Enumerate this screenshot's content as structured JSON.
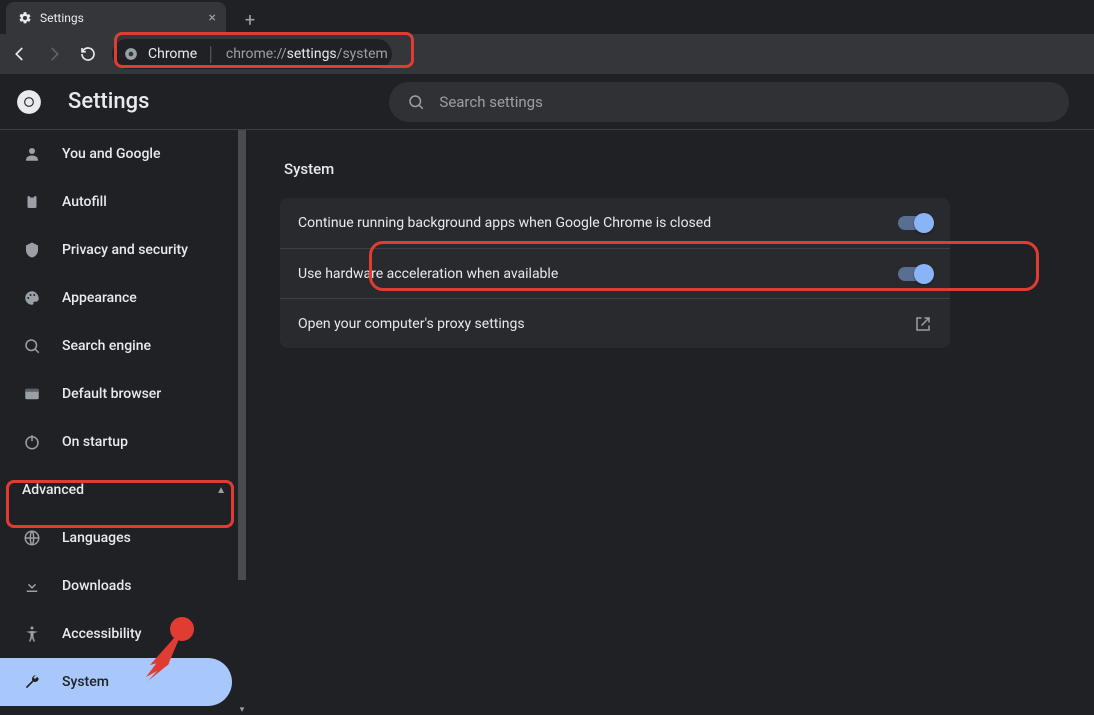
{
  "tab": {
    "title": "Settings"
  },
  "omnibox": {
    "chip": "Chrome",
    "url_prefix": "chrome://",
    "url_emph": "settings",
    "url_suffix": "/system"
  },
  "header": {
    "app_title": "Settings",
    "search_placeholder": "Search settings"
  },
  "sidebar": {
    "items": [
      {
        "id": "you",
        "label": "You and Google"
      },
      {
        "id": "autofill",
        "label": "Autofill"
      },
      {
        "id": "privacy",
        "label": "Privacy and security"
      },
      {
        "id": "appearance",
        "label": "Appearance"
      },
      {
        "id": "search",
        "label": "Search engine"
      },
      {
        "id": "default",
        "label": "Default browser"
      },
      {
        "id": "startup",
        "label": "On startup"
      }
    ],
    "advanced_label": "Advanced",
    "advanced_items": [
      {
        "id": "languages",
        "label": "Languages"
      },
      {
        "id": "downloads",
        "label": "Downloads"
      },
      {
        "id": "accessibility",
        "label": "Accessibility"
      },
      {
        "id": "system",
        "label": "System",
        "selected": true
      }
    ]
  },
  "main": {
    "section_title": "System",
    "rows": [
      {
        "id": "bg-apps",
        "label": "Continue running background apps when Google Chrome is closed",
        "toggle": true
      },
      {
        "id": "hw-accel",
        "label": "Use hardware acceleration when available",
        "toggle": true
      },
      {
        "id": "proxy",
        "label": "Open your computer's proxy settings",
        "external": true
      }
    ]
  }
}
